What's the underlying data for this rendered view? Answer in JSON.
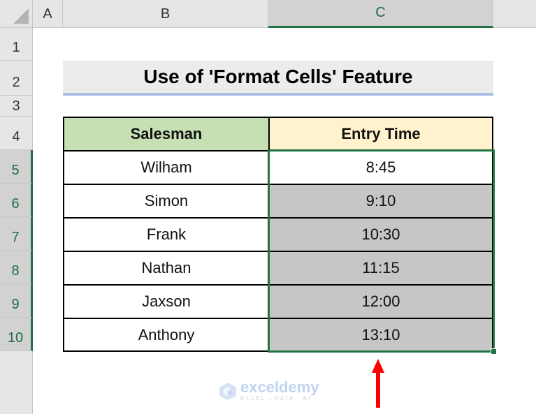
{
  "columns": [
    "A",
    "B",
    "C"
  ],
  "selected_column": "C",
  "rows": [
    "1",
    "2",
    "3",
    "4",
    "5",
    "6",
    "7",
    "8",
    "9",
    "10"
  ],
  "selected_rows": [
    "5",
    "6",
    "7",
    "8",
    "9",
    "10"
  ],
  "title": "Use of 'Format Cells' Feature",
  "table": {
    "headers": [
      "Salesman",
      "Entry Time"
    ],
    "header_colors": [
      "#c6e0b4",
      "#fff2cc"
    ],
    "rows": [
      {
        "salesman": "Wilham",
        "entry_time": "8:45"
      },
      {
        "salesman": "Simon",
        "entry_time": "9:10"
      },
      {
        "salesman": "Frank",
        "entry_time": "10:30"
      },
      {
        "salesman": "Nathan",
        "entry_time": "11:15"
      },
      {
        "salesman": "Jaxson",
        "entry_time": "12:00"
      },
      {
        "salesman": "Anthony",
        "entry_time": "13:10"
      }
    ],
    "shaded_fill": "#c6c6c6"
  },
  "selection": {
    "range": "C5:C10",
    "color": "#217346"
  },
  "annotation": {
    "arrow_color": "#ff0000",
    "arrow_icon": "up-arrow-icon"
  },
  "watermark": {
    "name": "exceldemy",
    "tagline": "EXCEL · DATA · BI"
  }
}
